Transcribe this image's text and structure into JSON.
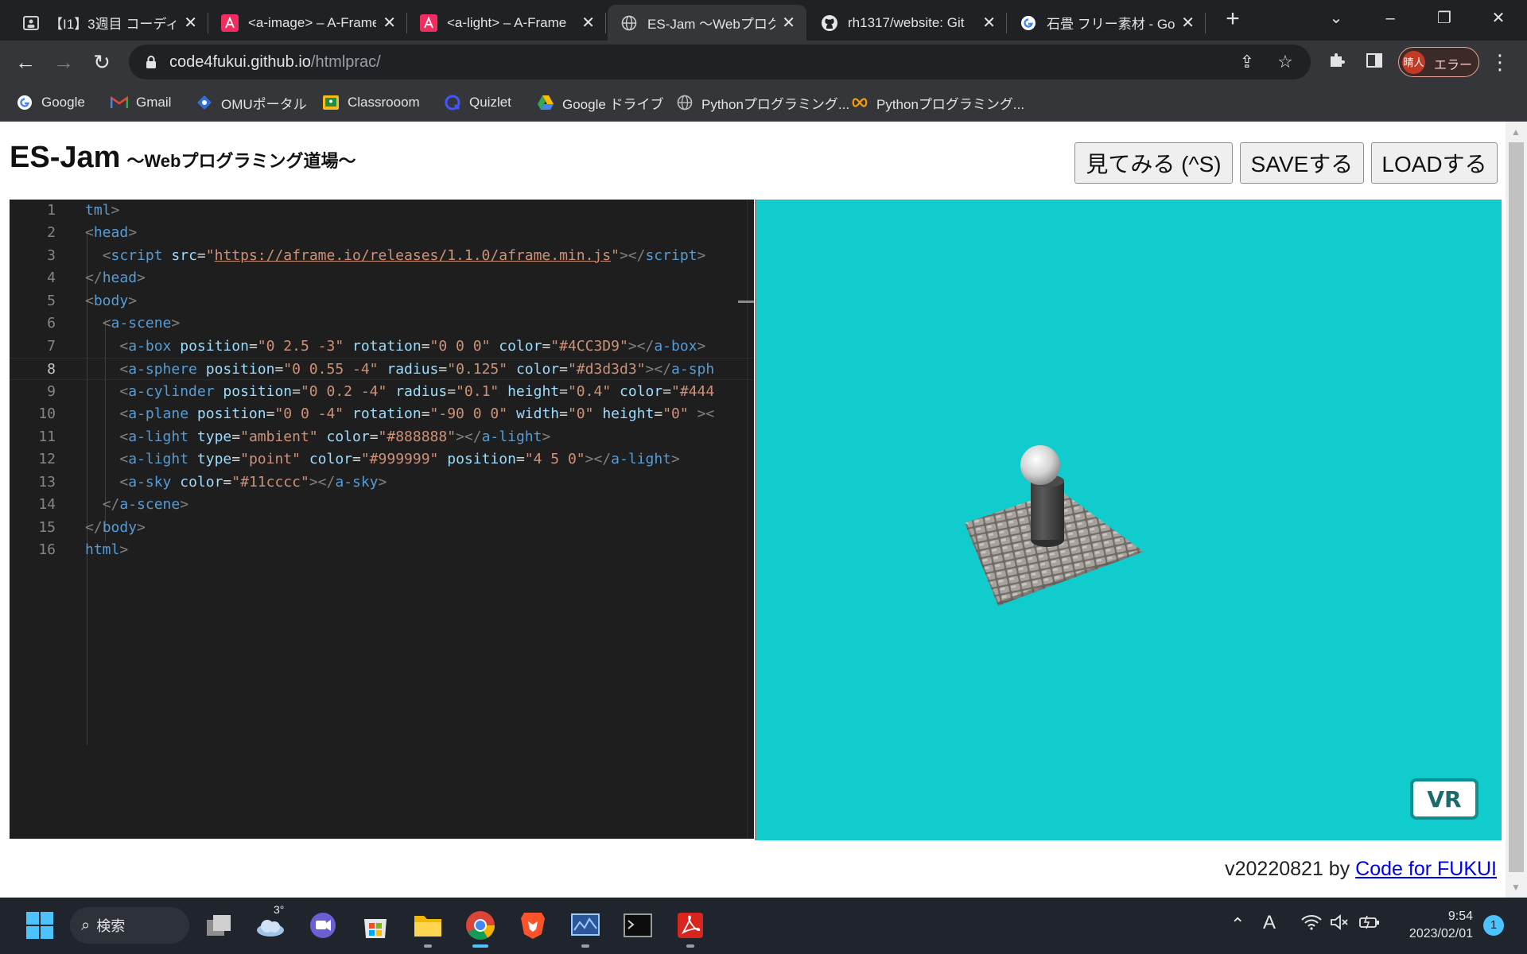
{
  "browser": {
    "tabs": [
      {
        "title": "【I1】3週目 コーディング",
        "active": false
      },
      {
        "title": "<a-image> – A-Frame",
        "active": false
      },
      {
        "title": "<a-light> – A-Frame",
        "active": false
      },
      {
        "title": "ES-Jam 〜Webプログラ",
        "active": true
      },
      {
        "title": "rh1317/website: Git",
        "active": false
      },
      {
        "title": "石畳 フリー素材 - Go",
        "active": false
      }
    ],
    "url_host": "code4fukui.github.io",
    "url_path": "/htmlprac/",
    "profile_label": "エラー",
    "profile_avatar": "晴人",
    "bookmarks": [
      "Google",
      "Gmail",
      "OMUポータル",
      "Classrooom",
      "Quizlet",
      "Google ドライブ",
      "Pythonプログラミング...",
      "Pythonプログラミング..."
    ]
  },
  "page": {
    "title": "ES-Jam",
    "subtitle": "〜Webプログラミング道場〜",
    "buttons": {
      "view": "見てみる (^S)",
      "save": "SAVEする",
      "load": "LOADする"
    },
    "vr_label": "VR",
    "footer_version": "v20220821 by ",
    "footer_link": "Code for FUKUI",
    "colors": {
      "sky": "#11cccc",
      "editor_bg": "#1e1e1e"
    }
  },
  "code_lines": [
    {
      "n": "1"
    },
    {
      "n": "2"
    },
    {
      "n": "3"
    },
    {
      "n": "4"
    },
    {
      "n": "5"
    },
    {
      "n": "6"
    },
    {
      "n": "7"
    },
    {
      "n": "8"
    },
    {
      "n": "9"
    },
    {
      "n": "10"
    },
    {
      "n": "11"
    },
    {
      "n": "12"
    },
    {
      "n": "13"
    },
    {
      "n": "14"
    },
    {
      "n": "15"
    },
    {
      "n": "16"
    }
  ],
  "code": {
    "l1": [
      "tml",
      ">"
    ],
    "l2": [
      "<",
      "head",
      ">"
    ],
    "l3": [
      "<",
      "script",
      "src",
      "=",
      "\"",
      "https://aframe.io/releases/1.1.0/aframe.min.js",
      "\"",
      "></",
      "script",
      ">"
    ],
    "l4": [
      "</",
      "head",
      ">"
    ],
    "l5": [
      "<",
      "body",
      ">"
    ],
    "l6": [
      "<",
      "a-scene",
      ">"
    ],
    "l7": [
      "<",
      "a-box",
      "position",
      "\"0 2.5 -3\"",
      "rotation",
      "\"0 0 0\"",
      "color",
      "\"#4CC3D9\"",
      "></",
      "a-box",
      ">"
    ],
    "l8": [
      "<",
      "a-sphere",
      "position",
      "\"0 0.55 -4\"",
      "radius",
      "\"0.125\"",
      "color",
      "\"#d3d3d3\"",
      "></",
      "a-sph"
    ],
    "l9": [
      "<",
      "a-cylinder",
      "position",
      "\"0 0.2 -4\"",
      "radius",
      "\"0.1\"",
      "height",
      "\"0.4\"",
      "color",
      "\"#444"
    ],
    "l10": [
      "<",
      "a-plane",
      "position",
      "\"0 0 -4\"",
      "rotation",
      "\"-90 0 0\"",
      "width",
      "\"0\"",
      "height",
      "\"0\"",
      "><"
    ],
    "l11": [
      "<",
      "a-light",
      "type",
      "\"ambient\"",
      "color",
      "\"#888888\"",
      "></",
      "a-light",
      ">"
    ],
    "l12": [
      "<",
      "a-light",
      "type",
      "\"point\"",
      "color",
      "\"#999999\"",
      "position",
      "\"4 5 0\"",
      "></",
      "a-light",
      ">"
    ],
    "l13": [
      "<",
      "a-sky",
      "color",
      "\"#11cccc\"",
      "></",
      "a-sky",
      ">"
    ],
    "l14": [
      "</",
      "a-scene",
      ">"
    ],
    "l15": [
      "</",
      "body",
      ">"
    ],
    "l16": [
      "html",
      ">"
    ]
  },
  "taskbar": {
    "search_label": "検索",
    "weather_temp": "3°",
    "ime": "A",
    "time": "9:54",
    "date": "2023/02/01",
    "notifications": "1"
  }
}
